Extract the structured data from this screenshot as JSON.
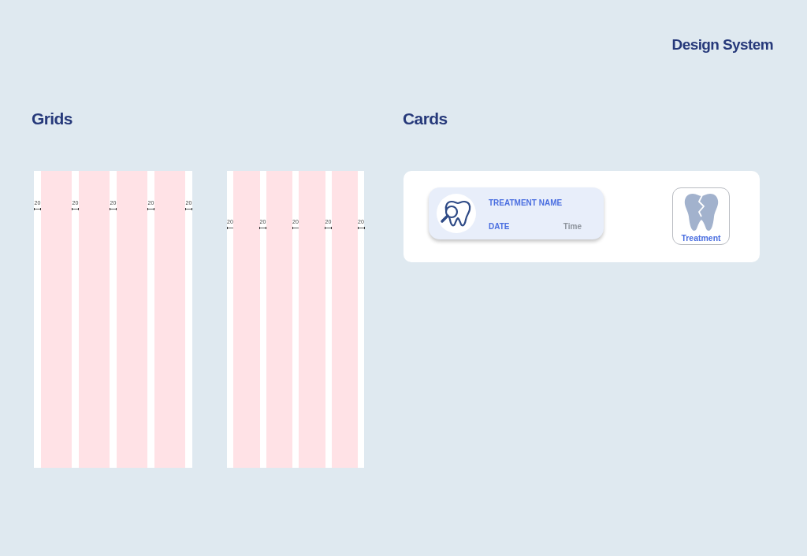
{
  "header": {
    "title": "Design System"
  },
  "grids": {
    "title": "Grids",
    "layouts": [
      {
        "gutters": [
          "20",
          "20",
          "20",
          "20",
          "20"
        ]
      },
      {
        "gutters": [
          "20",
          "20",
          "20",
          "20",
          "20"
        ]
      }
    ]
  },
  "cards": {
    "title": "Cards",
    "treatment_card": {
      "name": "TREATMENT NAME",
      "date": "DATE",
      "time": "Time"
    },
    "treatment_tile": {
      "label": "Treatment"
    }
  }
}
